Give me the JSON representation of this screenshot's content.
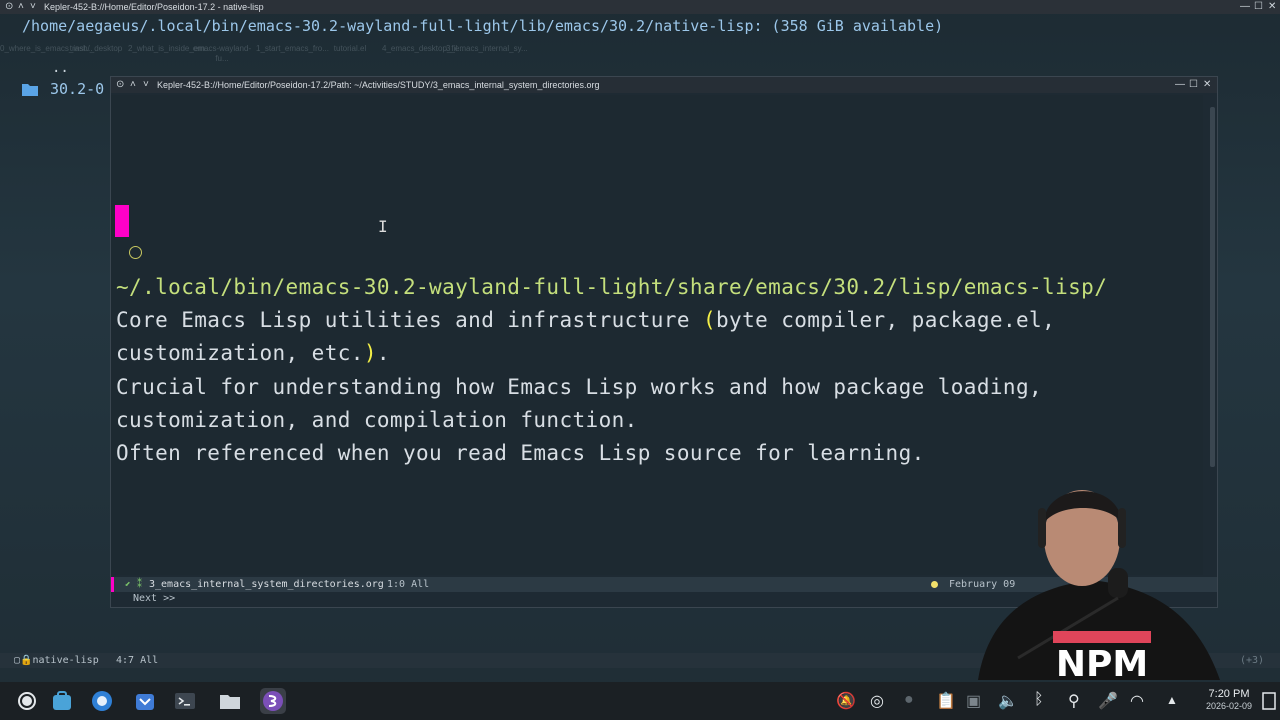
{
  "outer_window": {
    "title": "Kepler-452-B://Home/Editor/Poseidon-17.2 - native-lisp",
    "path": "/home/aegaeus/.local/bin/emacs-30.2-wayland-full-light/lib/emacs/30.2/native-lisp: (358 GiB available)",
    "ghost_files": [
      "0_where_is_emacs_inst...",
      "trash/_desktop",
      "2_what_is_inside_em...",
      "emacs-wayland-fu...",
      "1_start_emacs_fro...",
      "tutorial.el",
      "4_emacs_desktop_fil...",
      "3_emacs_internal_sy..."
    ],
    "dots": "..",
    "dir_entry": "30.2-0",
    "modeline": {
      "buffer": "native-lisp",
      "position": "4:7 All",
      "extra": "(+3)"
    }
  },
  "inner_window": {
    "title": "Kepler-452-B://Home/Editor/Poseidon-17.2/Path: ~/Activities/STUDY/3_emacs_internal_system_directories.org",
    "heading_path": "~/.local/bin/emacs-30.2-wayland-full-light/share/emacs/30.2/lisp/emacs-lisp/",
    "body_lines": [
      {
        "pre": "Core Emacs Lisp utilities and infrastructure ",
        "paren_open": "(",
        "mid": "byte compiler, package.el,",
        "post": ""
      },
      {
        "pre": "customization, etc.",
        "paren_close": ")",
        "post": "."
      },
      {
        "text": "Crucial for understanding how Emacs Lisp works and how package loading,"
      },
      {
        "text": "customization, and compilation function."
      },
      {
        "text": "Often referenced when you read Emacs Lisp source for learning."
      }
    ],
    "modeline": {
      "buffer": "3_emacs_internal_system_directories.org",
      "position": "1:0 All",
      "date": "February 09"
    },
    "minibuffer": "Next >>"
  },
  "taskbar": {
    "time": "7:20 PM",
    "date": "2026-02-09",
    "apps": [
      "system-menu-icon",
      "store-icon",
      "browser-icon",
      "package-manager-icon",
      "terminal-icon",
      "files-icon",
      "emacs-icon"
    ],
    "tray": [
      "notifications-off-icon",
      "recording-icon",
      "dot-icon",
      "clipboard-icon",
      "briefcase-icon",
      "volume-icon",
      "bluetooth-icon",
      "location-icon",
      "microphone-icon",
      "wifi-icon",
      "tray-expand-icon"
    ]
  },
  "webcam": {
    "shirt_text": "NPM"
  },
  "colors": {
    "accent": "#ff00c8",
    "path": "#c4df7c",
    "paren": "#f3ef47",
    "bg": "#1d2931"
  }
}
